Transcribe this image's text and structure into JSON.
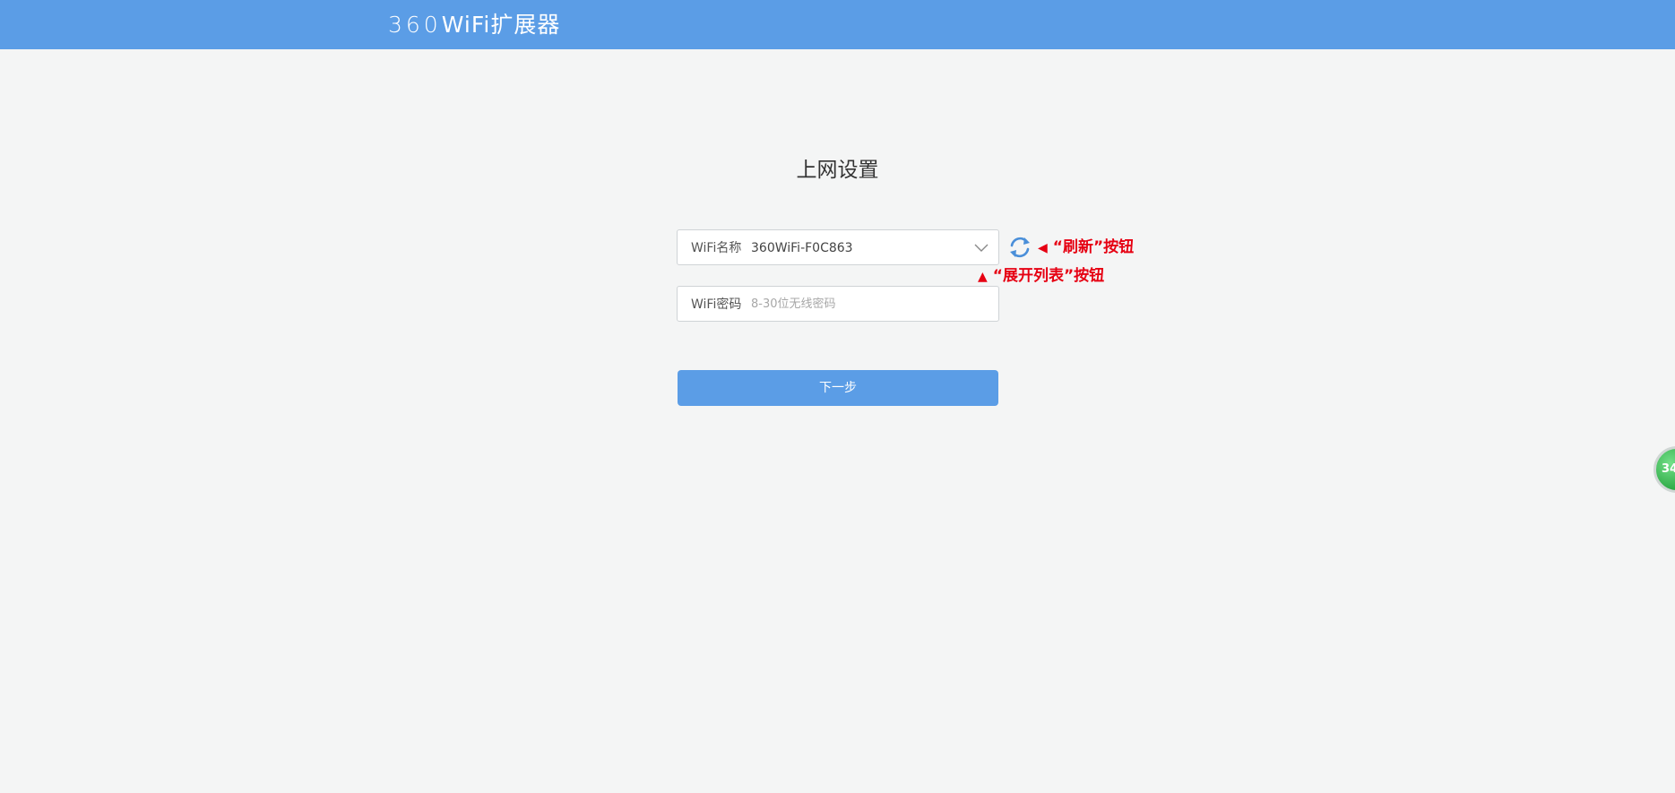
{
  "header": {
    "logo_num": "360",
    "logo_text": "WiFi扩展器"
  },
  "main": {
    "title": "上网设置",
    "ssid": {
      "label": "WiFi名称",
      "value": "360WiFi-F0C863"
    },
    "password": {
      "label": "WiFi密码",
      "placeholder": "8-30位无线密码",
      "value": ""
    },
    "next_button": "下一步"
  },
  "annotations": {
    "refresh_arrow": "◀",
    "refresh": "“刷新”按钮",
    "expand_arrow": "▲",
    "expand": "“展开列表”按钮"
  },
  "floating_badge": "34",
  "colors": {
    "header_bg": "#5b9de6",
    "button_bg": "#5b9de6",
    "annotation": "#e60012",
    "page_bg": "#f4f5f5"
  },
  "icons": [
    "refresh-icon",
    "chevron-down-icon"
  ]
}
